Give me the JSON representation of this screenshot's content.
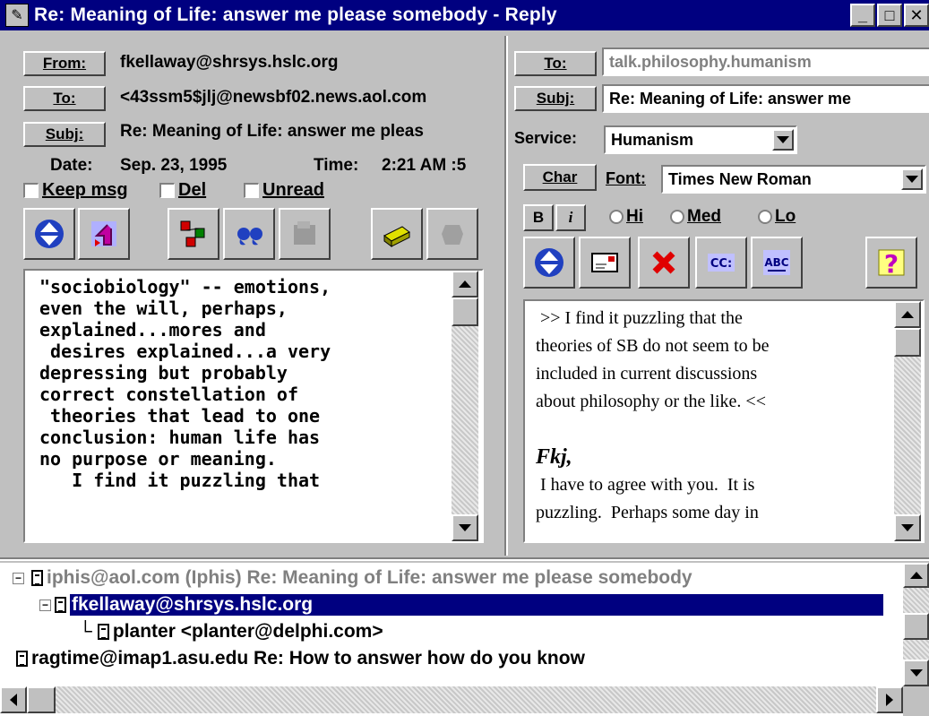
{
  "window": {
    "title": "Re: Meaning of Life: answer me please somebody - Reply",
    "minimize_glyph": "_",
    "maximize_glyph": "□",
    "close_glyph": "✕"
  },
  "left": {
    "from_label": "From:",
    "from_value": "fkellaway@shrsys.hslc.org",
    "to_label": "To:",
    "to_value": "<43ssm5$jlj@newsbf02.news.aol.com",
    "subj_label": "Subj:",
    "subj_value": "Re: Meaning of Life: answer me pleas",
    "date_label": "Date:",
    "date_value": "Sep. 23, 1995",
    "time_label": "Time:",
    "time_value": "2:21 AM :5",
    "keep_label": "Keep msg",
    "del_label": "Del",
    "unread_label": "Unread",
    "message_lines": [
      "\"sociobiology\" -- emotions,",
      "even the will, perhaps,",
      "explained...mores and",
      " desires explained...a very",
      "depressing but probably",
      "correct constellation of",
      " theories that lead to one",
      "conclusion: human life has",
      "no purpose or meaning.",
      "   I find it puzzling that"
    ]
  },
  "right": {
    "to_label": "To:",
    "to_value": "talk.philosophy.humanism",
    "subj_label": "Subj:",
    "subj_value": "Re: Meaning of Life: answer me",
    "service_label": "Service:",
    "service_value": "Humanism",
    "char_label": "Char",
    "font_label": "Font:",
    "font_value": "Times New Roman",
    "bold_label": "B",
    "italic_label": "i",
    "hi_label": "Hi",
    "med_label": "Med",
    "lo_label": "Lo",
    "reply_lines": [
      " >> I find it puzzling that the",
      "theories of SB do not seem to be",
      "included in current discussions",
      "about philosophy or the like. <<",
      "",
      "Fkj,",
      " I have to agree with you.  It is",
      "puzzling.  Perhaps some day in"
    ]
  },
  "tree": {
    "rows": [
      {
        "text": "iphis@aol.com (Iphis)  Re: Meaning of Life: answer me please somebody",
        "state": "dim"
      },
      {
        "text": "fkellaway@shrsys.hslc.org",
        "state": "selected"
      },
      {
        "text": "planter <planter@delphi.com>",
        "state": "normal"
      },
      {
        "text": "ragtime@imap1.asu.edu  Re: How to answer how do you know",
        "state": "normal"
      }
    ]
  },
  "colors": {
    "titlebar": "#000080",
    "face": "#c0c0c0",
    "selection": "#000080",
    "dim_text": "#808080"
  }
}
